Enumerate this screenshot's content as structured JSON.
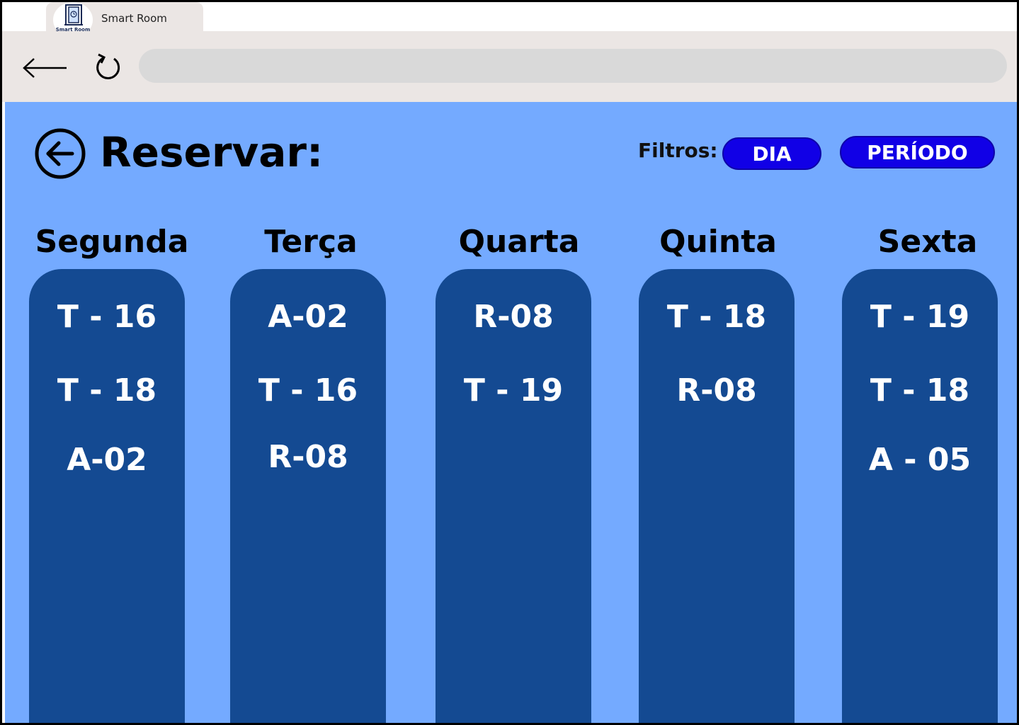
{
  "browser": {
    "tab_title": "Smart Room",
    "logo_text": "Smart Room"
  },
  "page": {
    "title": "Reservar:",
    "filters_label": "Filtros:",
    "filter_day": "DIA",
    "filter_period": "PERÍODO"
  },
  "days": [
    {
      "name": "Segunda",
      "rooms": [
        "T - 16",
        "T - 18",
        "A-02"
      ]
    },
    {
      "name": "Terça",
      "rooms": [
        "A-02",
        "T - 16",
        "R-08"
      ]
    },
    {
      "name": "Quarta",
      "rooms": [
        "R-08",
        "T - 19"
      ]
    },
    {
      "name": "Quinta",
      "rooms": [
        "T - 18",
        "R-08"
      ]
    },
    {
      "name": "Sexta",
      "rooms": [
        "T - 19",
        "T - 18",
        "A - 05"
      ]
    }
  ],
  "colors": {
    "background": "#74aaff",
    "column": "#144a92",
    "filter_pill": "#1100e6",
    "browser_chrome": "#ebe6e4"
  }
}
